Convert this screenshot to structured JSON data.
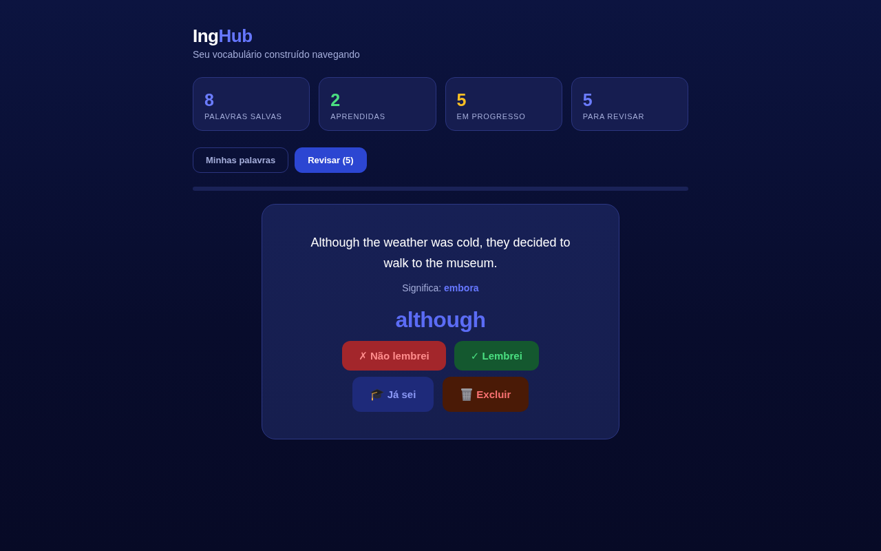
{
  "header": {
    "logo": {
      "part_1": "Ing",
      "part_2": "Hub"
    },
    "subtitle": "Seu vocabulário construído navegando"
  },
  "stats": [
    {
      "value": "8",
      "label": "PALAVRAS SALVAS",
      "color": "#6b7cff"
    },
    {
      "value": "2",
      "label": "APRENDIDAS",
      "color": "#4ade80"
    },
    {
      "value": "5",
      "label": "EM PROGRESSO",
      "color": "#fbbf24"
    },
    {
      "value": "5",
      "label": "PARA REVISAR",
      "color": "#6b7cff"
    }
  ],
  "tabs": [
    {
      "label": "Minhas palavras",
      "selected": false
    },
    {
      "label": "Revisar (5)",
      "selected": true
    }
  ],
  "review_card": {
    "sentence": "Although the weather was cold, they decided to walk to the museum.",
    "meaning": "Significa: **embora**",
    "word": "although",
    "actions": [
      {
        "kind": "forgot",
        "label": "✗ Não lembrei"
      },
      {
        "kind": "remembered",
        "label": "✓ Lembrei"
      },
      {
        "kind": "known",
        "label": "Já sei"
      },
      {
        "kind": "delete",
        "label": "Excluir"
      }
    ]
  }
}
